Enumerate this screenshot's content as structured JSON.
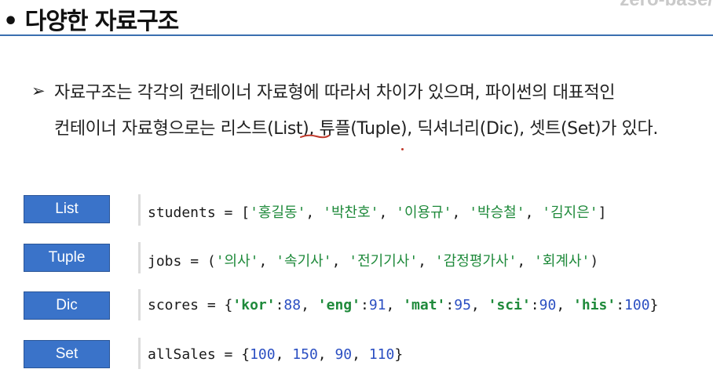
{
  "slide": {
    "title": "• 다양한 자료구조",
    "brand": "zero-base/"
  },
  "content": {
    "bullet": "➢",
    "line1": "자료구조는 각각의 컨테이너 자료형에 따라서 차이가 있으며, 파이썬의 대표적인",
    "line2": "컨테이너 자료형으로는 리스트(List), 튜플(Tuple), 딕셔너리(Dic), 셋트(Set)가 있다."
  },
  "rows": [
    {
      "label": "List",
      "code": {
        "var": "students",
        "op": " = [",
        "items": [
          "'홍길동'",
          "'박찬호'",
          "'이용규'",
          "'박승철'",
          "'김지은'"
        ],
        "close": "]"
      }
    },
    {
      "label": "Tuple",
      "code": {
        "var": "jobs",
        "op": " = (",
        "items": [
          "'의사'",
          "'속기사'",
          "'전기기사'",
          "'감정평가사'",
          "'회계사'"
        ],
        "close": ")"
      }
    },
    {
      "label": "Dic",
      "code": {
        "var": "scores",
        "op": " = {",
        "pairs": [
          {
            "k": "'kor'",
            "v": "88"
          },
          {
            "k": "'eng'",
            "v": "91"
          },
          {
            "k": "'mat'",
            "v": "95"
          },
          {
            "k": "'sci'",
            "v": "90"
          },
          {
            "k": "'his'",
            "v": "100"
          }
        ],
        "close": "}"
      }
    },
    {
      "label": "Set",
      "code": {
        "var": "allSales",
        "op": " = {",
        "nums": [
          "100",
          "150",
          "90",
          "110"
        ],
        "close": "}"
      }
    }
  ],
  "colors": {
    "accent": "#3a73c9",
    "string": "#1f8a3b",
    "number": "#2b4fc2",
    "annotation": "#c0392b"
  }
}
